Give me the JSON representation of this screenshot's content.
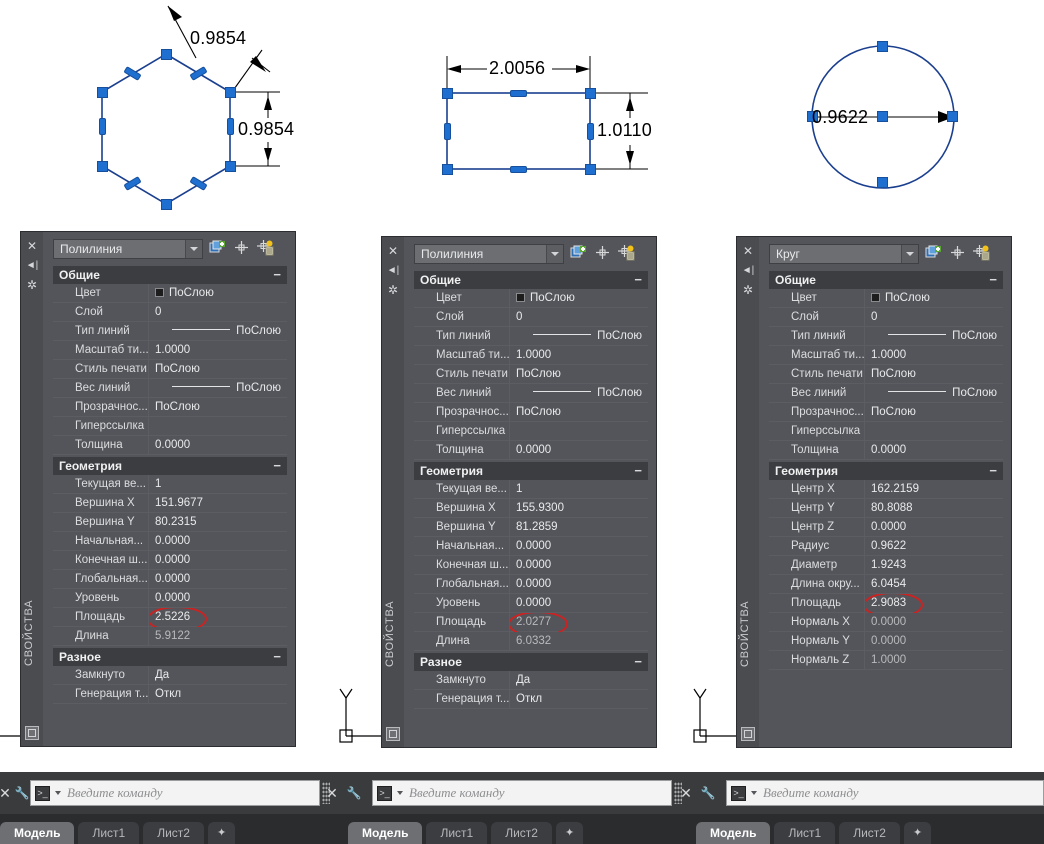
{
  "drawing": {
    "hexagon": {
      "name": "hexagon-entity",
      "dim_top": "0.9854",
      "dim_right": "0.9854"
    },
    "rectangle": {
      "name": "rectangle-entity",
      "dim_width": "2.0056",
      "dim_height": "1.0110"
    },
    "circle": {
      "name": "circle-entity",
      "dim_radius": "0.9622"
    },
    "ucs": {
      "y_label": "Y",
      "x_label": ""
    }
  },
  "colors": {
    "grip_fill": "#1f6fd0",
    "entity_stroke": "#1b3f8f",
    "highlight_ring": "#cc2222",
    "palette_bg": "#53555a",
    "section_header_bg": "#3b3d41"
  },
  "palettes": [
    {
      "title": "СВОЙСТВА",
      "object_type": "Полилиния",
      "header_buttons": [
        "toggle-pickadd-icon",
        "select-objects-icon",
        "quick-select-icon"
      ],
      "rail_icons": [
        "close-icon",
        "auto-hide-icon",
        "properties-menu-icon"
      ],
      "sections": [
        {
          "name": "Общие",
          "collapse": "−",
          "rows": [
            {
              "label": "Цвет",
              "value": "ПоСлою",
              "kind": "color"
            },
            {
              "label": "Слой",
              "value": "0",
              "kind": "text"
            },
            {
              "label": "Тип линий",
              "value": "ПоСлою",
              "kind": "linetype"
            },
            {
              "label": "Масштаб ти...",
              "value": "1.0000",
              "kind": "text"
            },
            {
              "label": "Стиль печати",
              "value": "ПоСлою",
              "kind": "text"
            },
            {
              "label": "Вес линий",
              "value": "ПоСлою",
              "kind": "linetype"
            },
            {
              "label": "Прозрачнос...",
              "value": "ПоСлою",
              "kind": "text"
            },
            {
              "label": "Гиперссылка",
              "value": "",
              "kind": "text"
            },
            {
              "label": "Толщина",
              "value": "0.0000",
              "kind": "text"
            }
          ]
        },
        {
          "name": "Геометрия",
          "collapse": "−",
          "rows": [
            {
              "label": "Текущая ве...",
              "value": "1",
              "kind": "text"
            },
            {
              "label": "Вершина X",
              "value": "151.9677",
              "kind": "text"
            },
            {
              "label": "Вершина Y",
              "value": "80.2315",
              "kind": "text"
            },
            {
              "label": "Начальная...",
              "value": "0.0000",
              "kind": "text"
            },
            {
              "label": "Конечная ш...",
              "value": "0.0000",
              "kind": "text"
            },
            {
              "label": "Глобальная...",
              "value": "0.0000",
              "kind": "text"
            },
            {
              "label": "Уровень",
              "value": "0.0000",
              "kind": "text"
            },
            {
              "label": "Площадь",
              "value": "2.5226",
              "kind": "text",
              "highlight": true
            },
            {
              "label": "Длина",
              "value": "5.9122",
              "kind": "dim"
            }
          ]
        },
        {
          "name": "Разное",
          "collapse": "−",
          "rows": [
            {
              "label": "Замкнуто",
              "value": "Да",
              "kind": "text"
            },
            {
              "label": "Генерация т...",
              "value": "Откл",
              "kind": "text"
            }
          ]
        }
      ]
    },
    {
      "title": "СВОЙСТВА",
      "object_type": "Полилиния",
      "header_buttons": [
        "toggle-pickadd-icon",
        "select-objects-icon",
        "quick-select-icon"
      ],
      "rail_icons": [
        "close-icon",
        "auto-hide-icon",
        "properties-menu-icon"
      ],
      "sections": [
        {
          "name": "Общие",
          "collapse": "−",
          "rows": [
            {
              "label": "Цвет",
              "value": "ПоСлою",
              "kind": "color"
            },
            {
              "label": "Слой",
              "value": "0",
              "kind": "text"
            },
            {
              "label": "Тип линий",
              "value": "ПоСлою",
              "kind": "linetype"
            },
            {
              "label": "Масштаб ти...",
              "value": "1.0000",
              "kind": "text"
            },
            {
              "label": "Стиль печати",
              "value": "ПоСлою",
              "kind": "text"
            },
            {
              "label": "Вес линий",
              "value": "ПоСлою",
              "kind": "linetype"
            },
            {
              "label": "Прозрачнос...",
              "value": "ПоСлою",
              "kind": "text"
            },
            {
              "label": "Гиперссылка",
              "value": "",
              "kind": "text"
            },
            {
              "label": "Толщина",
              "value": "0.0000",
              "kind": "text"
            }
          ]
        },
        {
          "name": "Геометрия",
          "collapse": "−",
          "rows": [
            {
              "label": "Текущая ве...",
              "value": "1",
              "kind": "text"
            },
            {
              "label": "Вершина X",
              "value": "155.9300",
              "kind": "text"
            },
            {
              "label": "Вершина Y",
              "value": "81.2859",
              "kind": "text"
            },
            {
              "label": "Начальная...",
              "value": "0.0000",
              "kind": "text"
            },
            {
              "label": "Конечная ш...",
              "value": "0.0000",
              "kind": "text"
            },
            {
              "label": "Глобальная...",
              "value": "0.0000",
              "kind": "text"
            },
            {
              "label": "Уровень",
              "value": "0.0000",
              "kind": "text"
            },
            {
              "label": "Площадь",
              "value": "2.0277",
              "kind": "dim",
              "highlight": true
            },
            {
              "label": "Длина",
              "value": "6.0332",
              "kind": "dim"
            }
          ]
        },
        {
          "name": "Разное",
          "collapse": "−",
          "rows": [
            {
              "label": "Замкнуто",
              "value": "Да",
              "kind": "text"
            },
            {
              "label": "Генерация т...",
              "value": "Откл",
              "kind": "text"
            }
          ]
        }
      ]
    },
    {
      "title": "СВОЙСТВА",
      "object_type": "Круг",
      "header_buttons": [
        "toggle-pickadd-icon",
        "select-objects-icon",
        "quick-select-icon"
      ],
      "rail_icons": [
        "close-icon",
        "auto-hide-icon",
        "properties-menu-icon"
      ],
      "sections": [
        {
          "name": "Общие",
          "collapse": "−",
          "rows": [
            {
              "label": "Цвет",
              "value": "ПоСлою",
              "kind": "color"
            },
            {
              "label": "Слой",
              "value": "0",
              "kind": "text"
            },
            {
              "label": "Тип линий",
              "value": "ПоСлою",
              "kind": "linetype"
            },
            {
              "label": "Масштаб ти...",
              "value": "1.0000",
              "kind": "text"
            },
            {
              "label": "Стиль печати",
              "value": "ПоСлою",
              "kind": "text"
            },
            {
              "label": "Вес линий",
              "value": "ПоСлою",
              "kind": "linetype"
            },
            {
              "label": "Прозрачнос...",
              "value": "ПоСлою",
              "kind": "text"
            },
            {
              "label": "Гиперссылка",
              "value": "",
              "kind": "text"
            },
            {
              "label": "Толщина",
              "value": "0.0000",
              "kind": "text"
            }
          ]
        },
        {
          "name": "Геометрия",
          "collapse": "−",
          "rows": [
            {
              "label": "Центр X",
              "value": "162.2159",
              "kind": "text"
            },
            {
              "label": "Центр Y",
              "value": "80.8088",
              "kind": "text"
            },
            {
              "label": "Центр Z",
              "value": "0.0000",
              "kind": "text"
            },
            {
              "label": "Радиус",
              "value": "0.9622",
              "kind": "text"
            },
            {
              "label": "Диаметр",
              "value": "1.9243",
              "kind": "text"
            },
            {
              "label": "Длина окру...",
              "value": "6.0454",
              "kind": "text"
            },
            {
              "label": "Площадь",
              "value": "2.9083",
              "kind": "text",
              "highlight": true
            },
            {
              "label": "Нормаль X",
              "value": "0.0000",
              "kind": "dim"
            },
            {
              "label": "Нормаль Y",
              "value": "0.0000",
              "kind": "dim"
            },
            {
              "label": "Нормаль Z",
              "value": "1.0000",
              "kind": "dim"
            }
          ]
        }
      ]
    }
  ],
  "command_bars": [
    {
      "placeholder": "Введите команду",
      "left_tools": [
        "close-icon",
        "customize-icon"
      ],
      "right_tools": [
        "drag-handle-icon",
        "close-icon",
        "customize-icon"
      ]
    },
    {
      "placeholder": "Введите команду",
      "left_tools": [
        "close-icon",
        "customize-icon"
      ],
      "right_tools": [
        "drag-handle-icon",
        "close-icon",
        "customize-icon"
      ]
    },
    {
      "placeholder": "Введите команду",
      "left_tools": [
        "close-icon",
        "customize-icon"
      ],
      "right_tools": []
    }
  ],
  "tab_bars": [
    {
      "tabs": [
        "Модель",
        "Лист1",
        "Лист2"
      ],
      "active": "Модель",
      "add_label": "✦"
    },
    {
      "tabs": [
        "Модель",
        "Лист1",
        "Лист2"
      ],
      "active": "Модель",
      "add_label": "✦"
    },
    {
      "tabs": [
        "Модель",
        "Лист1",
        "Лист2"
      ],
      "active": "Модель",
      "add_label": "✦"
    }
  ]
}
